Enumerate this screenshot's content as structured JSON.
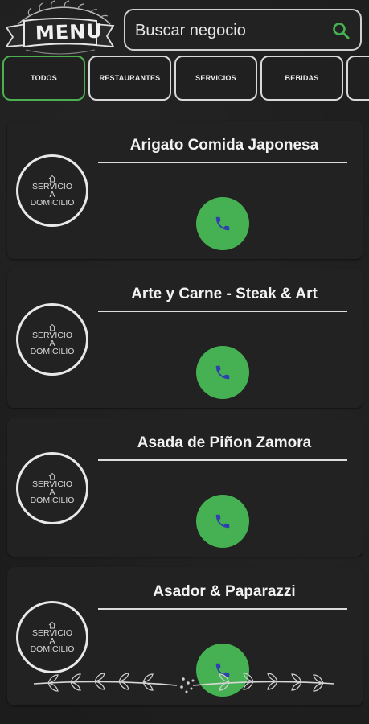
{
  "header": {
    "logo_text": "MENU",
    "search_placeholder": "Buscar negocio"
  },
  "tabs": [
    {
      "label": "TODOS",
      "active": true
    },
    {
      "label": "RESTAURANTES",
      "active": false
    },
    {
      "label": "SERVICIOS",
      "active": false
    },
    {
      "label": "BEBIDAS",
      "active": false
    },
    {
      "label": "",
      "active": false
    }
  ],
  "businesses": [
    {
      "name": "Arigato Comida Japonesa",
      "badge": [
        "SERVICIO",
        "A",
        "DOMICILIO"
      ]
    },
    {
      "name": "Arte y Carne - Steak & Art",
      "badge": [
        "SERVICIO",
        "A",
        "DOMICILIO"
      ]
    },
    {
      "name": "Asada de Piñon Zamora",
      "badge": [
        "SERVICIO",
        "A",
        "DOMICILIO"
      ]
    },
    {
      "name": "Asador & Paparazzi",
      "badge": [
        "SERVICIO",
        "A",
        "DOMICILIO"
      ]
    }
  ],
  "colors": {
    "accent": "#46b152",
    "phone_icon": "#2f3fb0",
    "background": "#1c1c1c"
  },
  "icons": [
    "search-icon",
    "phone-icon",
    "home-icon"
  ]
}
